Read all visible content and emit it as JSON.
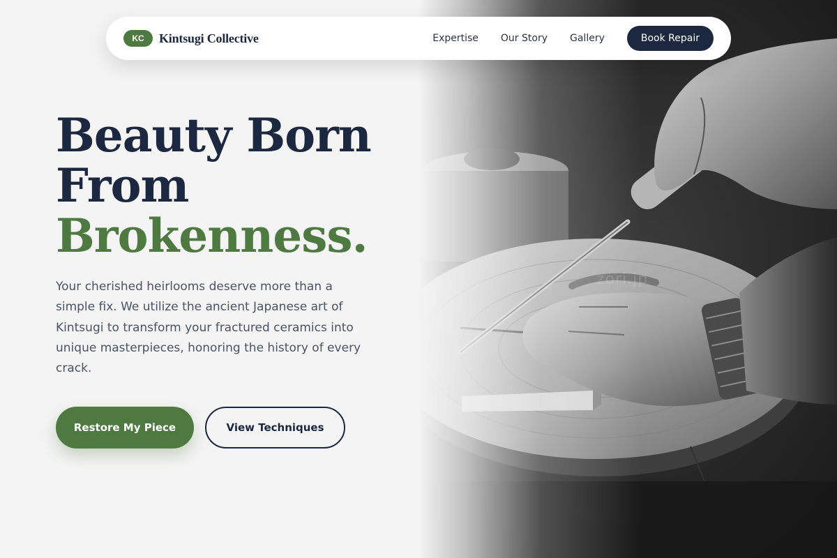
{
  "nav": {
    "logo_badge": "KC",
    "brand": "Kintsugi Collective",
    "links": [
      {
        "label": "Expertise"
      },
      {
        "label": "Our Story"
      },
      {
        "label": "Gallery"
      }
    ],
    "cta_label": "Book Repair"
  },
  "hero": {
    "title_line1": "Beauty Born",
    "title_line2": "From",
    "title_line3": "Brokenness.",
    "body": "Your cherished heirlooms deserve more than a simple fix. We utilize the ancient Japanese art of Kintsugi to transform your fractured ceramics into unique masterpieces, honoring the history of every crack.",
    "primary_button": "Restore My Piece",
    "secondary_button": "View Techniques"
  },
  "image": {
    "watermark": "zori.jp"
  },
  "colors": {
    "accent_green": "#4e7a42",
    "navy": "#1c2840",
    "background": "#f4f4f4",
    "body_text": "#4a5365"
  }
}
